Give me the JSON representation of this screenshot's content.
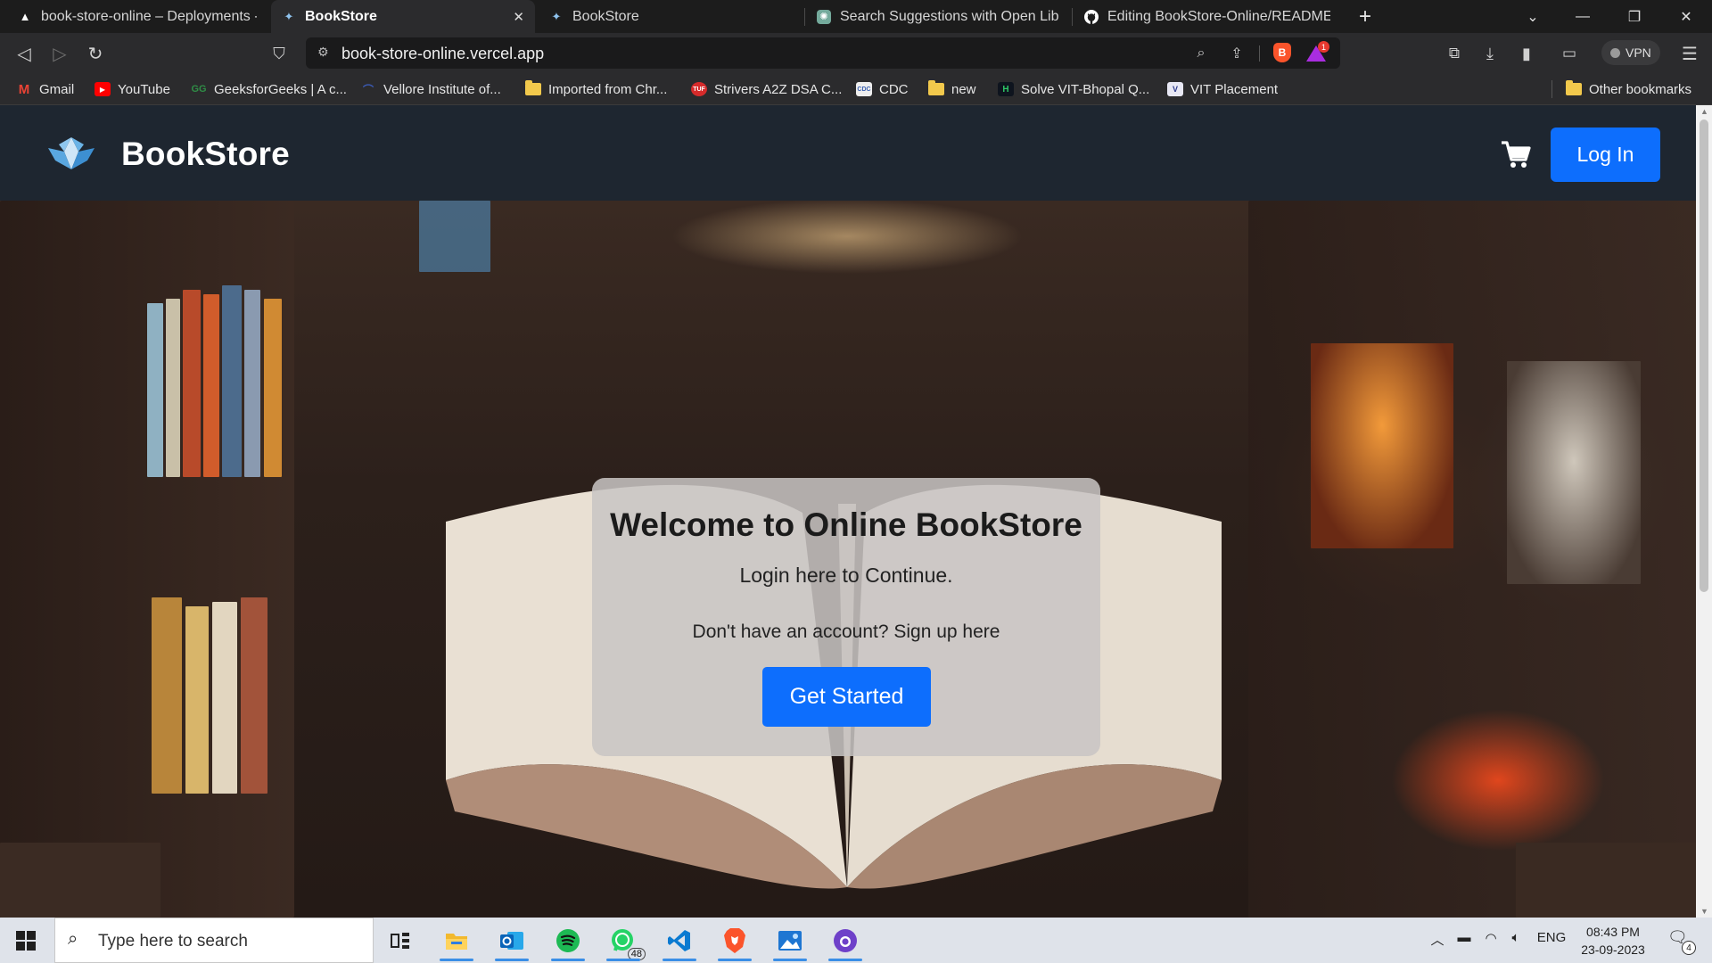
{
  "browser": {
    "tabs": [
      {
        "title": "book-store-online – Deployments - Ve",
        "icon": "vercel-triangle-icon",
        "active": false
      },
      {
        "title": "BookStore",
        "icon": "bookstore-logo-icon",
        "active": true
      },
      {
        "title": "BookStore",
        "icon": "bookstore-logo-icon",
        "active": false
      },
      {
        "title": "Search Suggestions with Open Library",
        "icon": "chatgpt-icon",
        "active": false
      },
      {
        "title": "Editing BookStore-Online/README.m",
        "icon": "github-icon",
        "active": false
      }
    ],
    "new_tab_glyph": "+",
    "address": {
      "url": "book-store-online.vercel.app"
    },
    "vpn_label": "VPN",
    "rewards_count": "1",
    "bookmarks": [
      {
        "label": "Gmail",
        "icon": "gmail-icon"
      },
      {
        "label": "YouTube",
        "icon": "youtube-icon"
      },
      {
        "label": "GeeksforGeeks | A c...",
        "icon": "geeksforgeeks-icon"
      },
      {
        "label": "Vellore Institute of...",
        "icon": "vit-icon"
      },
      {
        "label": "Imported from Chr...",
        "icon": "folder-icon"
      },
      {
        "label": "Strivers A2Z DSA C...",
        "icon": "tuf-icon"
      },
      {
        "label": "CDC",
        "icon": "cdc-icon"
      },
      {
        "label": "new",
        "icon": "folder-icon"
      },
      {
        "label": "Solve VIT-Bhopal Q...",
        "icon": "hackerrank-icon"
      },
      {
        "label": "VIT Placement",
        "icon": "vit-placement-icon"
      }
    ],
    "other_bookmarks": "Other bookmarks"
  },
  "site": {
    "brand": "BookStore",
    "login_label": "Log In",
    "cart_icon": "cart-icon",
    "card": {
      "title": "Welcome to Online BookStore",
      "subtitle": "Login here to Continue.",
      "signup_text": "Don't have an account? Sign up here",
      "cta_label": "Get Started"
    }
  },
  "taskbar": {
    "search_placeholder": "Type here to search",
    "apps": [
      {
        "name": "task-view-icon"
      },
      {
        "name": "file-explorer-icon"
      },
      {
        "name": "outlook-icon"
      },
      {
        "name": "spotify-icon"
      },
      {
        "name": "whatsapp-icon",
        "badge": "48"
      },
      {
        "name": "vscode-icon"
      },
      {
        "name": "brave-icon"
      },
      {
        "name": "photos-icon"
      },
      {
        "name": "github-desktop-icon"
      }
    ],
    "language": "ENG",
    "time": "08:43 PM",
    "date": "23-09-2023",
    "notification_count": "4"
  },
  "colors": {
    "primary_button": "#0d6efd",
    "site_header": "#1e2630",
    "brave_orange": "#fb542b"
  }
}
